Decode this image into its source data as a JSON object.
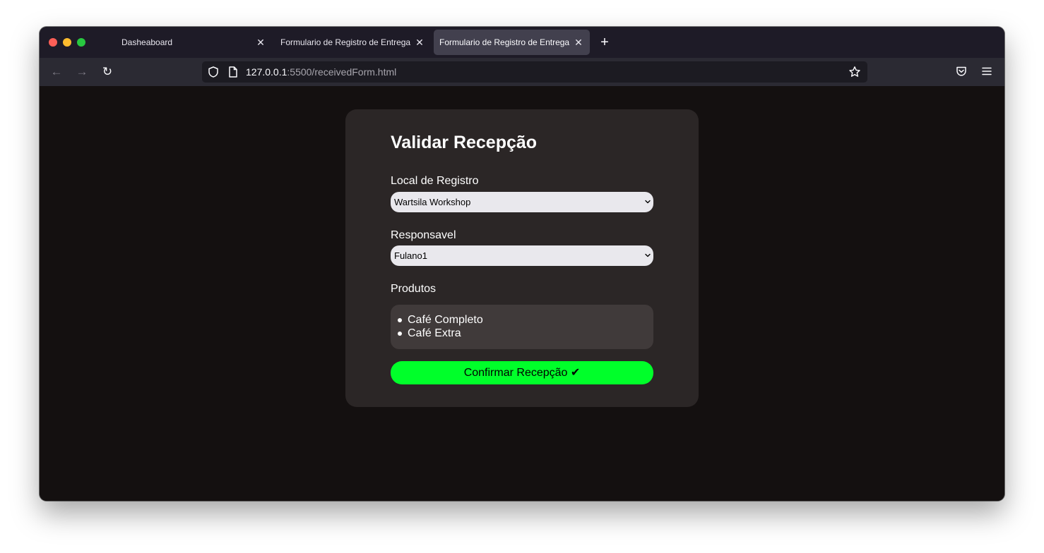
{
  "browser": {
    "tabs": [
      {
        "label": "Dasheaboard",
        "close": "✕"
      },
      {
        "label": "Formulario de Registro de Entrega",
        "close": "✕"
      },
      {
        "label": "Formulario de Registro de Entrega",
        "close": "✕"
      }
    ],
    "active_tab": 2,
    "new_tab": "+",
    "url_host": "127.0.0.1",
    "url_rest": ":5500/receivedForm.html",
    "icons": {
      "back": "←",
      "forward": "→",
      "reload": "↻"
    }
  },
  "form": {
    "title": "Validar Recepção",
    "local_label": "Local de Registro",
    "local_value": "Wartsila Workshop",
    "responsavel_label": "Responsavel",
    "responsavel_value": "Fulano1",
    "produtos_label": "Produtos",
    "produtos": [
      "Café Completo",
      "Café Extra"
    ],
    "confirm_label": "Confirmar Recepção ✔"
  },
  "colors": {
    "page_bg": "#141010",
    "card_bg": "#2b2626",
    "products_bg": "#403a3a",
    "confirm_bg": "#00ff2a",
    "select_bg": "#e9e8ed"
  }
}
